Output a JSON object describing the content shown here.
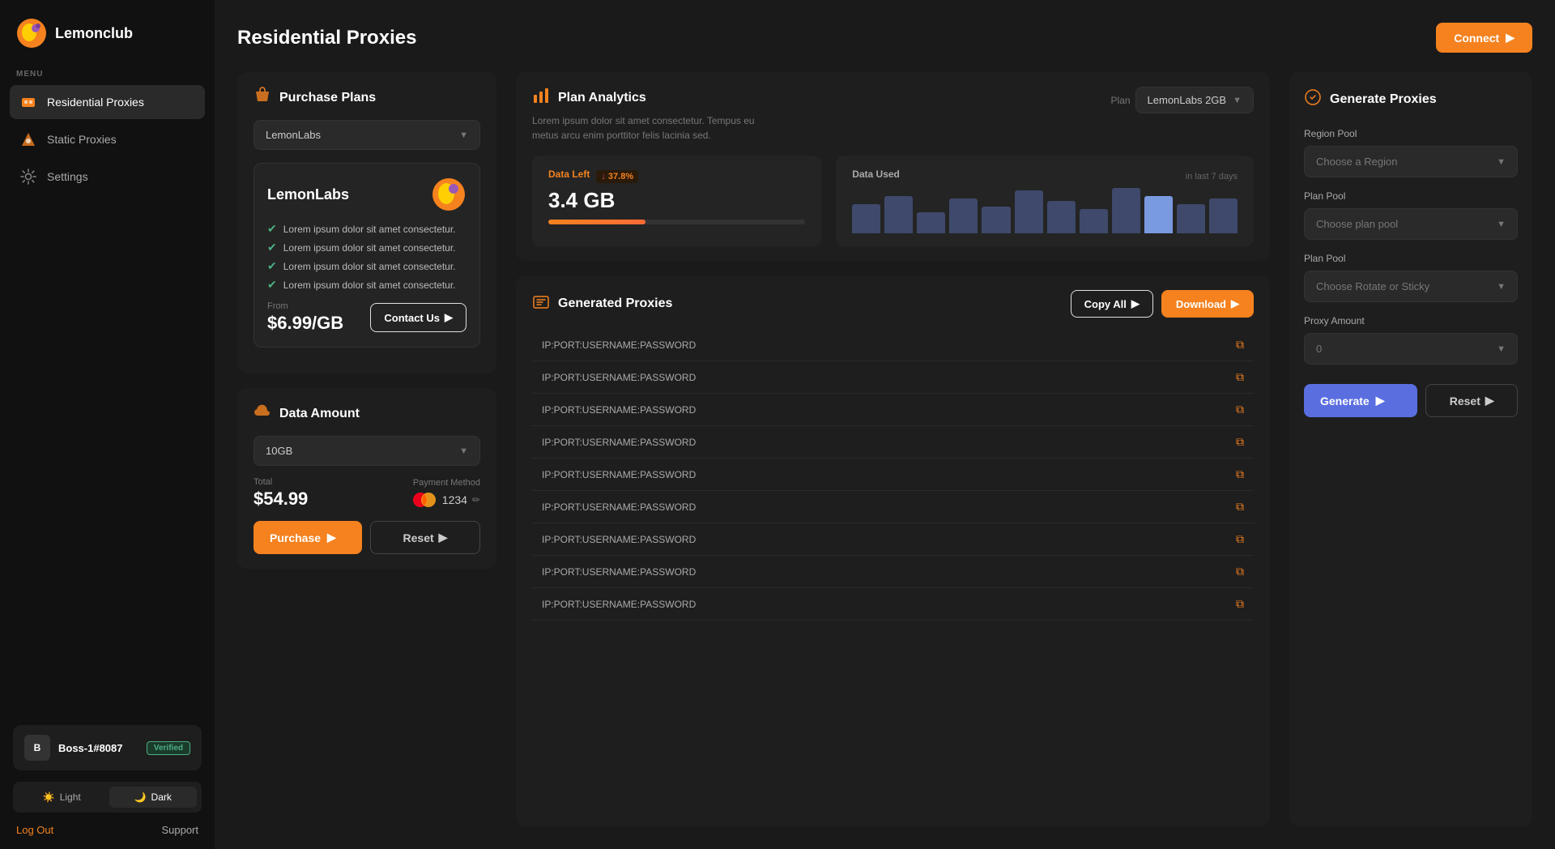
{
  "app": {
    "name": "Lemonclub",
    "connect_label": "Connect"
  },
  "sidebar": {
    "menu_label": "MENU",
    "items": [
      {
        "id": "residential-proxies",
        "label": "Residential Proxies",
        "active": true
      },
      {
        "id": "static-proxies",
        "label": "Static Proxies",
        "active": false
      },
      {
        "id": "settings",
        "label": "Settings",
        "active": false
      }
    ],
    "user": {
      "name": "Boss-1#8087",
      "verified_label": "Verified"
    },
    "theme": {
      "light_label": "Light",
      "dark_label": "Dark",
      "active": "dark"
    },
    "logout_label": "Log Out",
    "support_label": "Support"
  },
  "main": {
    "title": "Residential Proxies"
  },
  "purchase_plans": {
    "title": "Purchase Plans",
    "selected_plan": "LemonLabs",
    "plan_card": {
      "name": "LemonLabs",
      "features": [
        "Lorem ipsum dolor sit amet consectetur.",
        "Lorem ipsum dolor sit amet consectetur.",
        "Lorem ipsum dolor sit amet consectetur.",
        "Lorem ipsum dolor sit amet consectetur."
      ],
      "price_label": "From",
      "price": "$6.99/GB",
      "contact_us_label": "Contact Us"
    }
  },
  "data_amount": {
    "title": "Data Amount",
    "selected": "10GB",
    "total_label": "Total",
    "total": "$54.99",
    "payment_label": "Payment Method",
    "card_last4": "1234",
    "purchase_label": "Purchase",
    "reset_label": "Reset"
  },
  "plan_analytics": {
    "title": "Plan Analytics",
    "description": "Lorem ipsum dolor sit amet consectetur. Tempus eu metus arcu enim porttitor felis lacinia sed.",
    "plan_label": "Plan",
    "selected_plan": "LemonLabs 2GB",
    "data_left": {
      "label": "Data Left",
      "value": "3.4 GB",
      "badge": "37.8%",
      "bar_fill": 37.8
    },
    "data_used": {
      "label": "Data Used",
      "sub_label": "in last 7 days",
      "bars": [
        55,
        70,
        40,
        65,
        50,
        80,
        60,
        45,
        85,
        70,
        55,
        65
      ]
    }
  },
  "generated_proxies": {
    "title": "Generated Proxies",
    "copy_all_label": "Copy All",
    "download_label": "Download",
    "proxies": [
      "IP:PORT:USERNAME:PASSWORD",
      "IP:PORT:USERNAME:PASSWORD",
      "IP:PORT:USERNAME:PASSWORD",
      "IP:PORT:USERNAME:PASSWORD",
      "IP:PORT:USERNAME:PASSWORD",
      "IP:PORT:USERNAME:PASSWORD",
      "IP:PORT:USERNAME:PASSWORD",
      "IP:PORT:USERNAME:PASSWORD",
      "IP:PORT:USERNAME:PASSWORD"
    ]
  },
  "generate_proxies": {
    "title": "Generate Proxies",
    "region_pool_label": "Region Pool",
    "region_placeholder": "Choose a Region",
    "plan_pool_label": "Plan Pool",
    "plan_pool_placeholder": "Choose plan pool",
    "plan_pool2_label": "Plan Pool",
    "plan_pool2_placeholder": "Choose Rotate or Sticky",
    "proxy_amount_label": "Proxy Amount",
    "proxy_amount_value": "0",
    "generate_label": "Generate",
    "reset_label": "Reset"
  }
}
